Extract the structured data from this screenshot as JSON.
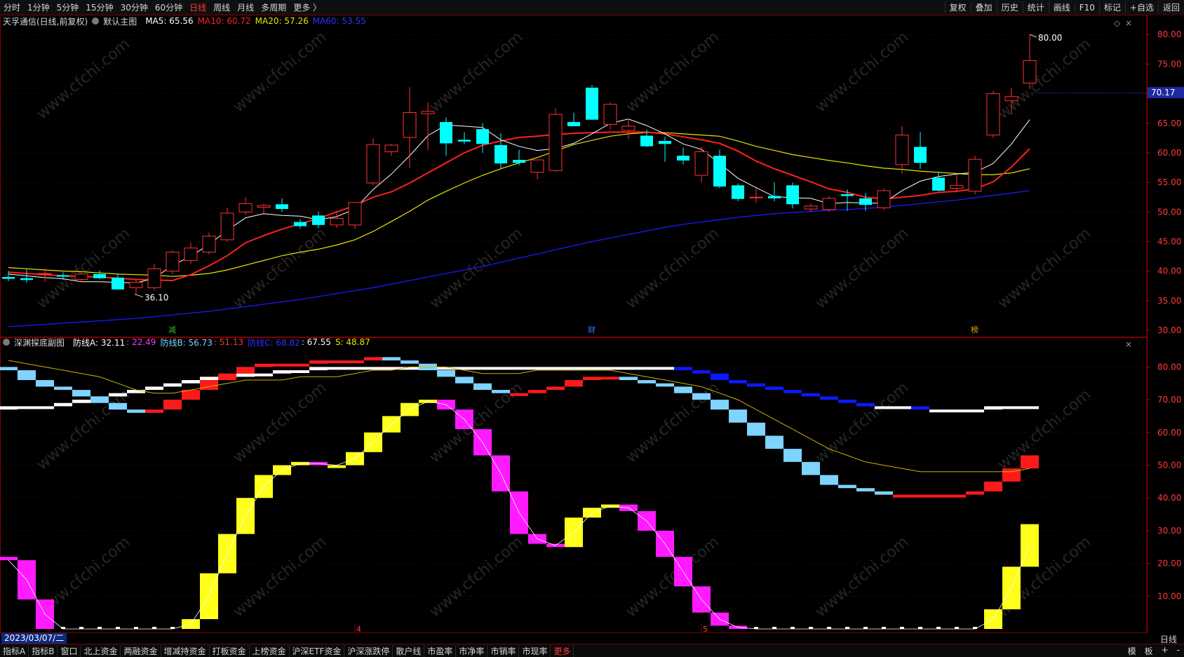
{
  "top_bar": {
    "periods": [
      "分时",
      "1分钟",
      "5分钟",
      "15分钟",
      "30分钟",
      "60分钟",
      "日线",
      "周线",
      "月线",
      "多周期",
      "更多 〉"
    ],
    "active_period": "日线",
    "right_tabs": [
      "复权",
      "叠加",
      "历史",
      "统计",
      "画线",
      "F10",
      "标记",
      "+自选",
      "返回"
    ]
  },
  "main_legend": {
    "title": "天孚通信(日线,前复权)",
    "indicator": "默认主图",
    "ma5": "MA5: 65.56",
    "ma10": "MA10: 60.72",
    "ma20": "MA20: 57.26",
    "ma60": "MA60: 53.55"
  },
  "sub_legend": {
    "title": "深渊探底副图",
    "a_label": "防线A: 32.11",
    "a_val2": ": 22.49",
    "b_label": "防线B: 56.73",
    "b_val2": ": 51.13",
    "c_label": "防线C: 68.82",
    "c_val2": ": 67.55",
    "s_label": "S: 48.87"
  },
  "colors": {
    "up": "#ff3232",
    "down": "#00ffff",
    "ma5": "#ffffff",
    "ma10": "#ff2020",
    "ma20": "#e6e600",
    "ma60": "#1a1aff",
    "grid": "#600000"
  },
  "chart_data": [
    {
      "type": "candlestick",
      "title": "天孚通信(日线,前复权)",
      "y_axis_ticks": [
        "80.00",
        "75.00",
        "70.00",
        "65.00",
        "60.00",
        "55.00",
        "50.00",
        "45.00",
        "40.00",
        "35.00",
        "30.00"
      ],
      "ylim": [
        30,
        80.5
      ],
      "current_price": "70.17",
      "max_label": "80.00",
      "min_label": "36.10",
      "ohlc": [
        [
          39.0,
          40.0,
          38.3,
          38.7
        ],
        [
          38.8,
          40.3,
          38.0,
          38.5
        ],
        [
          39.5,
          40.5,
          38.2,
          39.6
        ],
        [
          39.3,
          39.8,
          38.5,
          39.1
        ],
        [
          38.6,
          39.7,
          38.1,
          39.5
        ],
        [
          39.5,
          40.1,
          38.6,
          38.8
        ],
        [
          38.9,
          39.6,
          37.4,
          36.9
        ],
        [
          37.2,
          38.5,
          36.1,
          38.1
        ],
        [
          37.2,
          41.2,
          36.8,
          40.4
        ],
        [
          40.0,
          43.5,
          39.5,
          43.2
        ],
        [
          41.8,
          44.8,
          41.2,
          43.9
        ],
        [
          43.2,
          46.5,
          42.8,
          45.9
        ],
        [
          45.3,
          50.7,
          45.0,
          49.8
        ],
        [
          50.0,
          52.5,
          49.5,
          51.4
        ],
        [
          50.8,
          51.4,
          49.8,
          51.1
        ],
        [
          51.3,
          52.3,
          50.0,
          50.5
        ],
        [
          48.3,
          48.8,
          47.2,
          47.6
        ],
        [
          49.4,
          50.1,
          47.3,
          47.8
        ],
        [
          47.8,
          50.2,
          47.3,
          48.9
        ],
        [
          47.8,
          50.8,
          47.1,
          51.6
        ],
        [
          54.9,
          62.5,
          54.5,
          61.4
        ],
        [
          60.2,
          61.5,
          59.5,
          61.3
        ],
        [
          62.6,
          71.1,
          57.5,
          66.8
        ],
        [
          66.6,
          68.5,
          60.5,
          67.0
        ],
        [
          65.2,
          66.0,
          59.5,
          61.6
        ],
        [
          62.2,
          63.5,
          61.5,
          61.9
        ],
        [
          64.0,
          65.0,
          60.0,
          61.5
        ],
        [
          61.3,
          63.3,
          57.4,
          58.2
        ],
        [
          58.8,
          60.5,
          57.9,
          58.3
        ],
        [
          56.7,
          58.5,
          55.5,
          58.8
        ],
        [
          57.0,
          67.5,
          56.8,
          66.5
        ],
        [
          65.2,
          66.8,
          64.7,
          64.5
        ],
        [
          71.0,
          71.5,
          65.5,
          65.6
        ],
        [
          64.8,
          68.5,
          64.0,
          68.2
        ],
        [
          63.8,
          65.8,
          62.3,
          64.5
        ],
        [
          62.9,
          63.9,
          61.0,
          61.1
        ],
        [
          62.0,
          62.7,
          58.5,
          61.5
        ],
        [
          59.5,
          60.9,
          58.0,
          58.7
        ],
        [
          56.2,
          61.0,
          55.0,
          60.2
        ],
        [
          59.5,
          60.5,
          54.0,
          54.3
        ],
        [
          54.5,
          54.8,
          51.8,
          52.2
        ],
        [
          52.5,
          54.0,
          51.5,
          52.5
        ],
        [
          52.7,
          55.0,
          51.8,
          52.3
        ],
        [
          54.5,
          55.0,
          50.6,
          51.3
        ],
        [
          50.5,
          51.5,
          50.0,
          51.0
        ],
        [
          50.4,
          52.7,
          50.0,
          52.3
        ],
        [
          53.0,
          53.8,
          50.2,
          52.7
        ],
        [
          52.3,
          53.2,
          50.2,
          51.2
        ],
        [
          50.7,
          54.0,
          50.3,
          53.6
        ],
        [
          58.0,
          64.5,
          56.5,
          63.0
        ],
        [
          61.0,
          63.5,
          57.3,
          58.3
        ],
        [
          55.8,
          56.8,
          53.5,
          53.6
        ],
        [
          54.0,
          56.5,
          53.3,
          54.5
        ],
        [
          53.5,
          59.5,
          53.0,
          58.9
        ],
        [
          63.0,
          70.5,
          62.5,
          70.0
        ],
        [
          68.8,
          71.0,
          66.5,
          69.5
        ],
        [
          71.8,
          80.0,
          70.8,
          75.6
        ]
      ],
      "ma5": [
        39.5,
        39.2,
        38.9,
        38.7,
        38.2,
        38.2,
        38.1,
        38.0,
        38.8,
        41.0,
        42.5,
        44.5,
        46.9,
        49.0,
        49.7,
        49.4,
        49.3,
        48.7,
        49.2,
        50.5,
        53.8,
        56.4,
        59.5,
        62.9,
        64.7,
        64.5,
        64.3,
        62.2,
        61.1,
        60.4,
        60.7,
        61.6,
        63.2,
        65.0,
        65.7,
        64.6,
        63.2,
        61.5,
        60.6,
        58.2,
        55.7,
        54.1,
        52.6,
        52.4,
        52.3,
        51.4,
        51.6,
        51.5,
        51.5,
        53.6,
        55.2,
        56.0,
        56.4,
        56.7,
        58.2,
        61.5,
        65.6
      ],
      "ma10": [
        39.8,
        39.6,
        39.4,
        39.2,
        39.1,
        39.0,
        38.8,
        38.6,
        38.5,
        38.4,
        39.4,
        40.9,
        42.6,
        44.8,
        46.0,
        47.1,
        48.0,
        48.9,
        50.0,
        51.1,
        52.5,
        53.4,
        54.9,
        56.6,
        58.3,
        60.0,
        61.3,
        62.0,
        62.6,
        62.8,
        63.1,
        63.3,
        63.4,
        63.5,
        63.5,
        63.5,
        63.2,
        62.7,
        62.2,
        61.6,
        60.3,
        58.6,
        57.3,
        56.2,
        55.1,
        53.9,
        53.3,
        52.5,
        52.2,
        52.5,
        52.8,
        53.3,
        53.5,
        53.9,
        55.1,
        57.6,
        60.7
      ],
      "ma20": [
        40.6,
        40.4,
        40.2,
        40.0,
        39.9,
        39.7,
        39.5,
        39.4,
        39.3,
        39.1,
        39.3,
        39.6,
        40.2,
        41.0,
        41.8,
        42.6,
        43.2,
        43.7,
        44.4,
        45.3,
        46.7,
        48.4,
        50.1,
        52.0,
        53.5,
        54.9,
        56.2,
        57.3,
        58.3,
        59.2,
        60.3,
        61.4,
        62.1,
        62.8,
        63.2,
        63.4,
        63.4,
        63.2,
        63.0,
        62.8,
        62.0,
        61.1,
        60.4,
        59.7,
        59.2,
        58.7,
        58.3,
        57.8,
        57.4,
        57.2,
        56.9,
        56.7,
        56.5,
        56.3,
        56.3,
        56.6,
        57.3
      ],
      "ma60": [
        30.6,
        30.8,
        31.0,
        31.2,
        31.4,
        31.6,
        31.8,
        32.0,
        32.3,
        32.6,
        32.9,
        33.2,
        33.6,
        34.0,
        34.4,
        34.8,
        35.2,
        35.7,
        36.2,
        36.7,
        37.2,
        37.8,
        38.4,
        39.0,
        39.6,
        40.2,
        40.8,
        41.5,
        42.2,
        42.9,
        43.6,
        44.3,
        45.0,
        45.6,
        46.2,
        46.8,
        47.4,
        47.9,
        48.3,
        48.7,
        49.1,
        49.4,
        49.7,
        49.9,
        50.1,
        50.3,
        50.4,
        50.6,
        50.8,
        51.1,
        51.4,
        51.7,
        52.0,
        52.4,
        52.8,
        53.2,
        53.6
      ]
    },
    {
      "type": "area",
      "title": "深渊探底副图",
      "y_axis_ticks": [
        "80.00",
        "70.00",
        "60.00",
        "50.00",
        "40.00",
        "30.00",
        "20.00",
        "10.00"
      ],
      "ylim": [
        0,
        88
      ],
      "series": [
        {
          "name": "防线A",
          "values": [
            21,
            9,
            0,
            0,
            0,
            0,
            0,
            0,
            0,
            0,
            3,
            17,
            29,
            40,
            47,
            50,
            51,
            50,
            50,
            54,
            60,
            65,
            69,
            70,
            67,
            61,
            53,
            42,
            29,
            26,
            25,
            34,
            37,
            38,
            36,
            30,
            22,
            13,
            5,
            1,
            0,
            0,
            0,
            0,
            0,
            0,
            0,
            0,
            0,
            0,
            0,
            0,
            0,
            0,
            6,
            19,
            32
          ]
        },
        {
          "name": "防线B",
          "values": [
            79,
            76,
            74,
            73,
            71,
            69,
            67,
            66,
            67,
            70,
            73,
            76,
            78,
            80,
            81,
            81,
            81,
            82,
            82,
            82,
            83,
            82,
            81,
            79,
            77,
            75,
            73,
            72,
            72,
            73,
            74,
            76,
            77,
            77,
            76,
            75,
            74,
            72,
            70,
            67,
            63,
            59,
            55,
            51,
            47,
            44,
            43,
            42,
            41,
            41,
            41,
            41,
            41,
            42,
            45,
            49,
            53
          ]
        },
        {
          "name": "防线C",
          "values": [
            68,
            68,
            68,
            69,
            70,
            71,
            72,
            73,
            74,
            75,
            76,
            77,
            77,
            78,
            78,
            79,
            79,
            80,
            80,
            80,
            80,
            80,
            80,
            80,
            80,
            80,
            80,
            80,
            80,
            80,
            80,
            80,
            80,
            80,
            80,
            80,
            80,
            79,
            78,
            76,
            75,
            74,
            73,
            72,
            71,
            70,
            69,
            68,
            68,
            68,
            67,
            67,
            67,
            67,
            68,
            68,
            68
          ]
        },
        {
          "name": "S",
          "values": [
            82,
            81,
            80,
            79,
            78,
            77,
            75,
            73,
            72,
            72,
            73,
            74,
            75,
            76,
            76,
            76,
            77,
            77,
            77,
            78,
            79,
            79,
            80,
            80,
            80,
            79,
            78,
            78,
            78,
            79,
            79,
            79,
            79,
            79,
            78,
            77,
            76,
            75,
            74,
            72,
            70,
            67,
            64,
            61,
            58,
            55,
            53,
            51,
            50,
            49,
            48,
            48,
            48,
            48,
            48,
            48,
            49
          ]
        }
      ]
    }
  ],
  "sub_x_labels": [
    "4",
    "5"
  ],
  "event_labels": [
    "减",
    "财",
    "榜"
  ],
  "bottom_bar": {
    "tabs": [
      "指标A",
      "指标B",
      "窗口",
      "北上资金",
      "两融资金",
      "增减持资金",
      "打板资金",
      "上榜资金",
      "沪深ETF资金",
      "沪深涨跌停",
      "散户线",
      "市盈率",
      "市净率",
      "市销率",
      "市现率",
      "更多"
    ],
    "right_tabs": [
      "模",
      "板",
      "+",
      "-"
    ],
    "date": "2023/03/07/二",
    "period_label": "日线"
  },
  "watermark": "www.cfchi.com"
}
